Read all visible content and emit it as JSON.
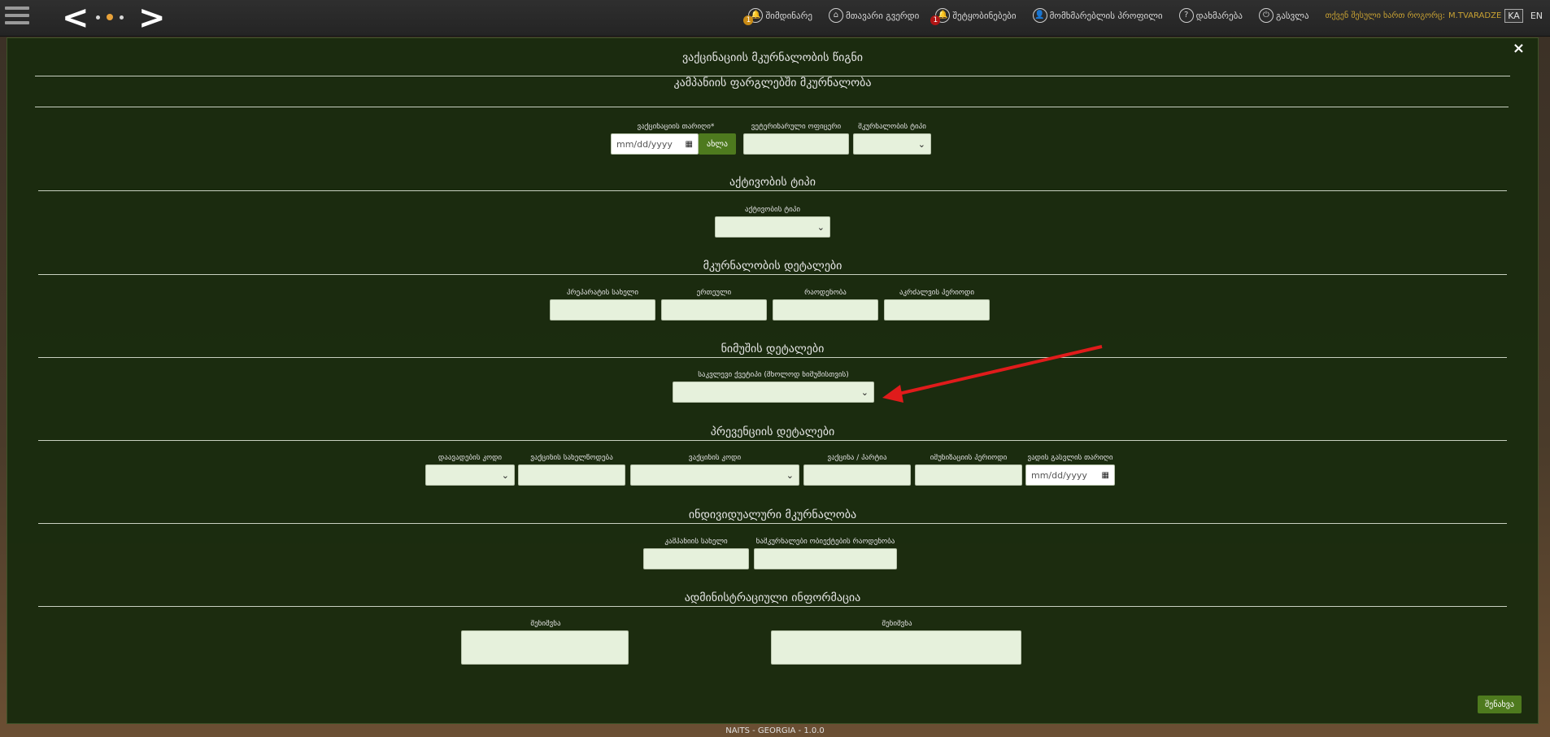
{
  "topbar": {
    "nav_prev": "<",
    "nav_next": ">",
    "items": [
      {
        "label": "შიმდინარე",
        "icon": "bell-icon",
        "glyph": "🔔",
        "badge": "1",
        "badge_color": "#c88a14"
      },
      {
        "label": "მთავარი გვერდი",
        "icon": "home-icon",
        "glyph": "⌂",
        "badge": "",
        "badge_color": ""
      },
      {
        "label": "შეტყობინებები",
        "icon": "notification-icon",
        "glyph": "🔔",
        "badge": "1",
        "badge_color": "#b01414"
      },
      {
        "label": "მომხმარებლის პროფილი",
        "icon": "user-icon",
        "glyph": "👤",
        "badge": "",
        "badge_color": ""
      },
      {
        "label": "დახმარება",
        "icon": "help-icon",
        "glyph": "?",
        "badge": "",
        "badge_color": ""
      },
      {
        "label": "გასვლა",
        "icon": "power-icon",
        "glyph": "⏻",
        "badge": "",
        "badge_color": ""
      }
    ],
    "user_label": "თქვენ შესული ხართ როგორც:",
    "user_name": "M.TVARADZE",
    "lang_active": "KA",
    "lang_other": "EN"
  },
  "modal": {
    "title": "ვაქცინაციის მკურნალობის წიგნი",
    "close": "×",
    "save_label": "შენახვა",
    "sections": {
      "campaign": "კამპანიის ფარგლებში მკურნალობა",
      "activity": "აქტივობის ტიპი",
      "treatment_details": "მკურნალობის დეტალები",
      "sample_details": "ნიმუშის დეტალები",
      "prevention_details": "პრევენციის დეტალები",
      "individual": "ინდივიდუალური მკურნალობა",
      "admin": "ადმინისტრაციული ინფორმაცია"
    },
    "fields": {
      "vaccination_date": "ვაქცინაციის თარიღი*",
      "date_placeholder": "mm/dd/yyyy",
      "now_button": "ახლა",
      "vet_officer": "ვეტერინარული ოფიცერი",
      "treatment_type": "მკურნალობის ტიპი",
      "activity_type": "აქტივობის ტიპი",
      "drug_name": "პრეპარატის სახელი",
      "unit": "ერთეული",
      "quantity": "რაოდენობა",
      "quarantine_period": "აკრძალვის პერიოდი",
      "sample_type": "საკვლევი ქვეტიპი (მხოლოდ ნიმუშისთვის)",
      "disease_code": "დაავადების კოდი",
      "vaccine_name": "ვაქცინის სახელწოდება",
      "vaccine_code": "ვაქცინის კოდი",
      "vaccine_lot": "ვაქცინა / პარტია",
      "immunization_period": "იმუნიზაციის პერიოდი",
      "expiry_date": "ვადის გასვლის თარიღი",
      "campaign_name": "კამპანიის სახელი",
      "treated_objects_count": "ნამკურნალები ობიექტების რაოდენობა",
      "note1": "შენიშვნა",
      "note2": "შენიშვნა"
    }
  },
  "footer": "NAITS - GEORGIA - 1.0.0",
  "colors": {
    "modal_bg": "#1a2b0e",
    "accent_green": "#4e7a1e",
    "input_bg": "#e6f1dc",
    "arrow": "#e01b1b"
  }
}
